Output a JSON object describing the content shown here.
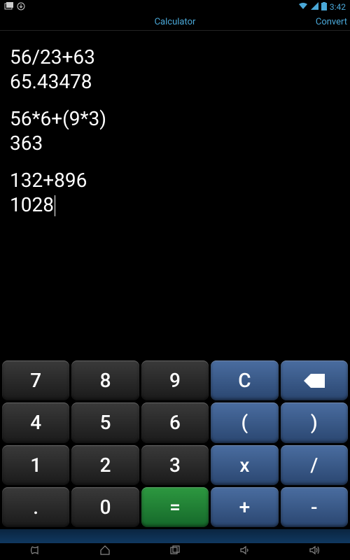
{
  "status": {
    "time": "3:42",
    "wifi_icon": "wifi",
    "battery_icon": "battery"
  },
  "header": {
    "title": "Calculator",
    "right_label": "Convert"
  },
  "history": [
    {
      "expression": "56/23+63",
      "result": "65.43478"
    },
    {
      "expression": "56*6+(9*3)",
      "result": "363"
    },
    {
      "expression": "132+896",
      "result": "1028"
    }
  ],
  "keypad": {
    "rows": [
      [
        {
          "label": "7",
          "type": "num",
          "name": "key-7"
        },
        {
          "label": "8",
          "type": "num",
          "name": "key-8"
        },
        {
          "label": "9",
          "type": "num",
          "name": "key-9"
        },
        {
          "label": "C",
          "type": "op",
          "name": "key-clear"
        },
        {
          "label": "◀",
          "type": "op",
          "name": "key-backspace",
          "icon": "backspace"
        }
      ],
      [
        {
          "label": "4",
          "type": "num",
          "name": "key-4"
        },
        {
          "label": "5",
          "type": "num",
          "name": "key-5"
        },
        {
          "label": "6",
          "type": "num",
          "name": "key-6"
        },
        {
          "label": "(",
          "type": "op",
          "name": "key-paren-open"
        },
        {
          "label": ")",
          "type": "op",
          "name": "key-paren-close"
        }
      ],
      [
        {
          "label": "1",
          "type": "num",
          "name": "key-1"
        },
        {
          "label": "2",
          "type": "num",
          "name": "key-2"
        },
        {
          "label": "3",
          "type": "num",
          "name": "key-3"
        },
        {
          "label": "x",
          "type": "op",
          "name": "key-multiply"
        },
        {
          "label": "/",
          "type": "op",
          "name": "key-divide"
        }
      ],
      [
        {
          "label": ".",
          "type": "num",
          "name": "key-decimal"
        },
        {
          "label": "0",
          "type": "num",
          "name": "key-0"
        },
        {
          "label": "=",
          "type": "eq",
          "name": "key-equals"
        },
        {
          "label": "+",
          "type": "op",
          "name": "key-plus"
        },
        {
          "label": "-",
          "type": "op",
          "name": "key-minus"
        }
      ]
    ]
  },
  "nav": {
    "back": "back",
    "home": "home",
    "recent": "recent",
    "vol_down": "vol-down",
    "vol_up": "vol-up"
  }
}
